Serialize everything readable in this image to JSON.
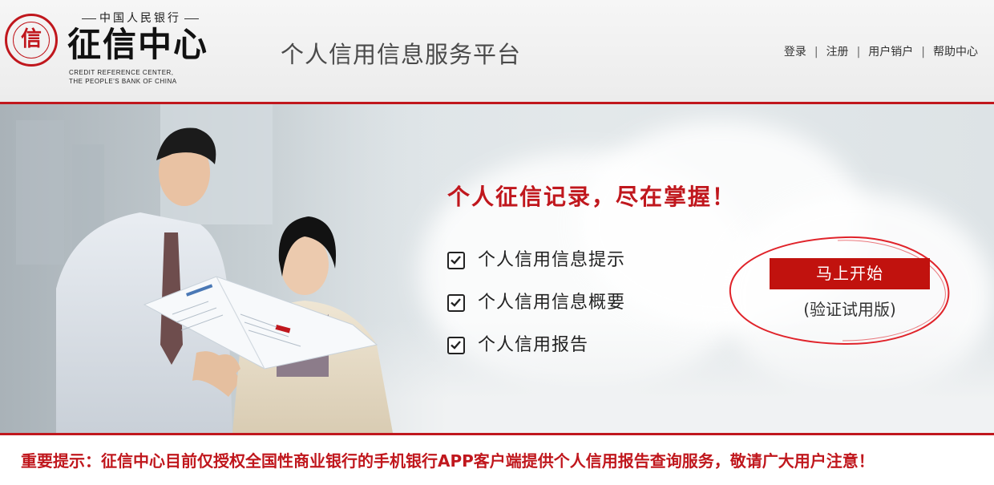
{
  "header": {
    "logo": {
      "seal_glyph": "信",
      "bank_name": "中国人民银行",
      "center_name": "征信中心",
      "english_line1": "CREDIT REFERENCE CENTER,",
      "english_line2": "THE PEOPLE'S BANK OF CHINA"
    },
    "platform_title": "个人信用信息服务平台",
    "nav": [
      {
        "label": "登录"
      },
      {
        "label": "注册"
      },
      {
        "label": "用户销户"
      },
      {
        "label": "帮助中心"
      }
    ],
    "nav_separator": "|"
  },
  "banner": {
    "slogan": "个人征信记录，尽在掌握！",
    "features": [
      {
        "label": "个人信用信息提示"
      },
      {
        "label": "个人信用信息概要"
      },
      {
        "label": "个人信用报告"
      }
    ],
    "start_button": "马上开始",
    "start_note": "(验证试用版)"
  },
  "notice": {
    "text": "重要提示：征信中心目前仅授权全国性商业银行的手机银行APP客户端提供个人信用报告查询服务，敬请广大用户注意！"
  },
  "colors": {
    "brand_red": "#c0171d",
    "button_red": "#c1120e",
    "header_bg": "#efefef",
    "text_dark": "#222222"
  },
  "icons": {
    "feature_checkbox": "checkbox-checked-icon",
    "logo": "seal-logo-icon"
  }
}
